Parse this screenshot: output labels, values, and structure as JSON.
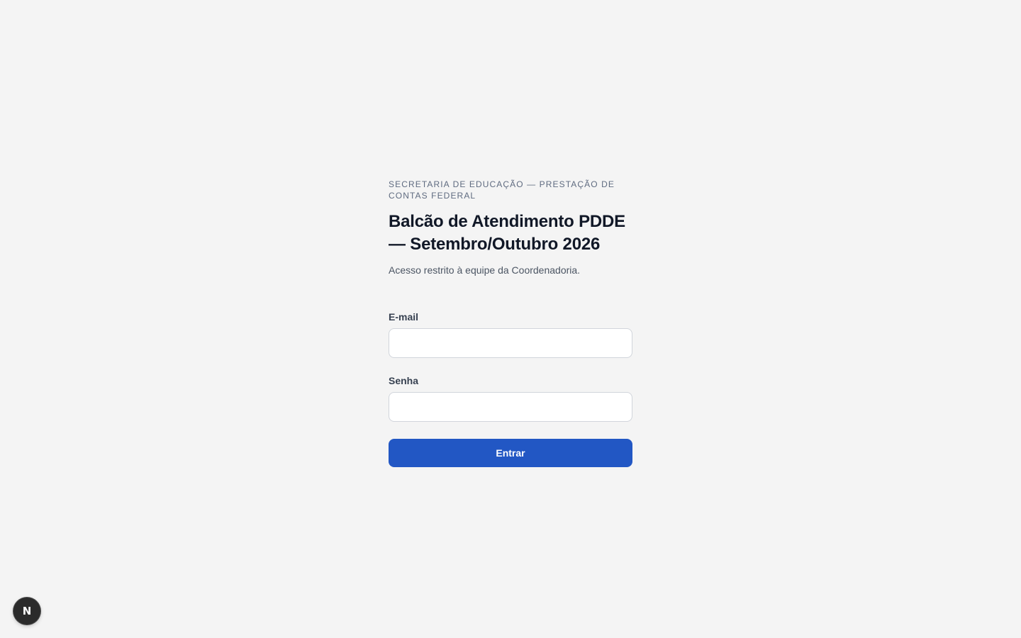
{
  "header": {
    "eyebrow": "SECRETARIA DE EDUCAÇÃO — PRESTAÇÃO DE CONTAS FEDERAL",
    "title": "Balcão de Atendimento PDDE — Setembro/Outubro 2026",
    "subtitle": "Acesso restrito à equipe da Coordenadoria."
  },
  "form": {
    "email": {
      "label": "E-mail",
      "value": "",
      "placeholder": ""
    },
    "password": {
      "label": "Senha",
      "value": "",
      "placeholder": ""
    },
    "submit_label": "Entrar"
  },
  "dev_badge": {
    "letter": "N",
    "icon": "nextjs-logo-icon"
  },
  "colors": {
    "background": "#f4f4f4",
    "primary": "#2257c4",
    "title": "#111827",
    "eyebrow": "#5f6b80"
  }
}
